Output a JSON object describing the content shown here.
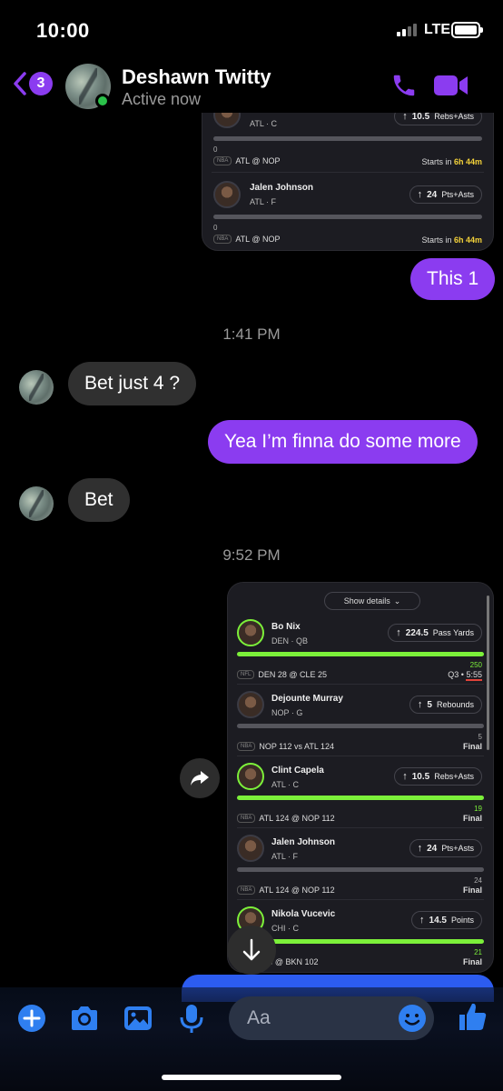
{
  "status_bar": {
    "time": "10:00",
    "network": "LTE"
  },
  "header": {
    "back_count": "3",
    "contact_name": "Deshawn Twitty",
    "contact_status": "Active now"
  },
  "screenshot1": {
    "rows": [
      {
        "team_pos": "ATL · C",
        "prop_value": "10.5",
        "prop_type": "Rebs+Asts",
        "progress": "0",
        "league": "NBA",
        "matchup": "ATL @ NOP",
        "status_prefix": "Starts in",
        "status_time": "6h 44m"
      },
      {
        "name": "Jalen Johnson",
        "team_pos": "ATL · F",
        "prop_value": "24",
        "prop_type": "Pts+Asts",
        "progress": "0",
        "league": "NBA",
        "matchup": "ATL @ NOP",
        "status_prefix": "Starts in",
        "status_time": "6h 44m"
      }
    ]
  },
  "messages": {
    "m1": "This 1",
    "time1": "1:41 PM",
    "m2": "Bet just 4 ?",
    "m3": "Yea I’m finna do some more",
    "m4": "Bet",
    "time2": "9:52 PM"
  },
  "screenshot2": {
    "show_details": "Show details",
    "rows": [
      {
        "name": "Bo Nix",
        "team_pos": "DEN · QB",
        "prop_value": "224.5",
        "prop_type": "Pass Yards",
        "progress": "250",
        "fill": 1.0,
        "league": "NFL",
        "matchup": "DEN 28 @ CLE 25",
        "status": "Q3 • 5:55",
        "status_q": "Q3 •",
        "status_clock": "5:55"
      },
      {
        "name": "Dejounte Murray",
        "team_pos": "NOP · G",
        "prop_value": "5",
        "prop_type": "Rebounds",
        "progress": "5",
        "fill": 1.0,
        "league": "NBA",
        "matchup": "NOP 112 vs ATL 124",
        "status": "Final"
      },
      {
        "name": "Clint Capela",
        "team_pos": "ATL · C",
        "prop_value": "10.5",
        "prop_type": "Rebs+Asts",
        "progress": "19",
        "fill": 1.0,
        "league": "NBA",
        "matchup": "ATL 124 @ NOP 112",
        "status": "Final"
      },
      {
        "name": "Jalen Johnson",
        "team_pos": "ATL · F",
        "prop_value": "24",
        "prop_type": "Pts+Asts",
        "progress": "24",
        "fill": 1.0,
        "league": "NBA",
        "matchup": "ATL 124 @ NOP 112",
        "status": "Final"
      },
      {
        "name": "Nikola Vucevic",
        "team_pos": "CHI · C",
        "prop_value": "14.5",
        "prop_type": "Points",
        "progress": "21",
        "fill": 1.0,
        "league": "NBA",
        "matchup": "128 @ BKN 102",
        "status": "Final"
      }
    ]
  },
  "composer": {
    "placeholder": "Aa"
  },
  "colors": {
    "accent": "#8b3cf0",
    "composer_accent": "#2f7ff0",
    "green": "#7cf03a",
    "online": "#2bc24a"
  }
}
